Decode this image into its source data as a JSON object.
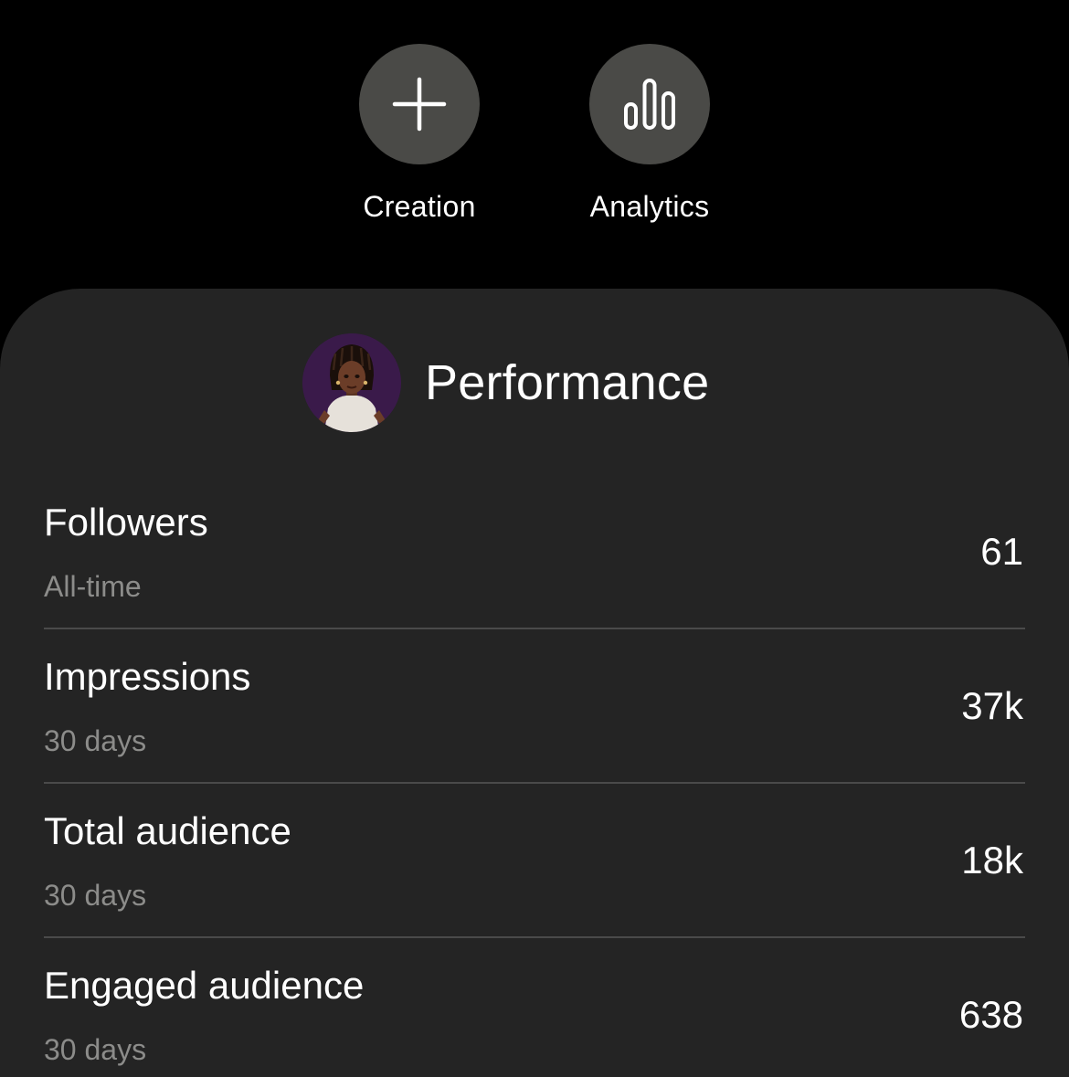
{
  "actions": [
    {
      "label": "Creation",
      "icon": "plus-icon"
    },
    {
      "label": "Analytics",
      "icon": "bar-chart-icon"
    }
  ],
  "performance": {
    "title": "Performance",
    "metrics": [
      {
        "label": "Followers",
        "period": "All-time",
        "value": "61"
      },
      {
        "label": "Impressions",
        "period": "30 days",
        "value": "37k"
      },
      {
        "label": "Total audience",
        "period": "30 days",
        "value": "18k"
      },
      {
        "label": "Engaged audience",
        "period": "30 days",
        "value": "638"
      }
    ]
  },
  "colors": {
    "background": "#000000",
    "card": "#242424",
    "action_circle": "#4a4a47",
    "divider": "#4a4a4a",
    "muted_text": "#8c8c8a",
    "avatar_background": "#3a1a4a"
  }
}
